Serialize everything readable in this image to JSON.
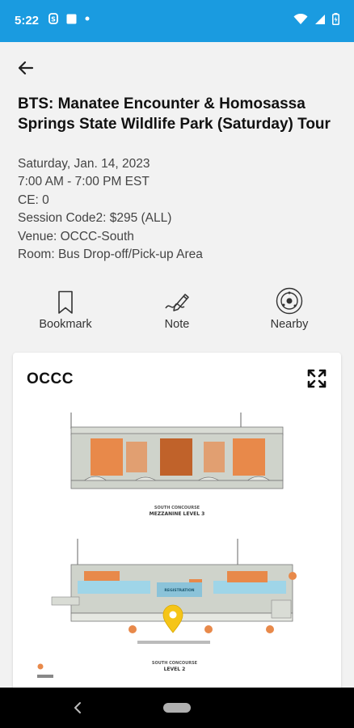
{
  "status_bar": {
    "time": "5:22"
  },
  "header": {
    "title": "BTS: Manatee Encounter & Homosassa Springs State Wildlife Park (Saturday) Tour"
  },
  "details": {
    "date": "Saturday, Jan. 14, 2023",
    "time": "7:00 AM - 7:00 PM EST",
    "ce": "CE: 0",
    "session_code": "Session Code2: $295 (ALL)",
    "venue": "Venue: OCCC-South",
    "room": "Room: Bus Drop-off/Pick-up Area"
  },
  "actions": {
    "bookmark": "Bookmark",
    "note": "Note",
    "nearby": "Nearby"
  },
  "map": {
    "title": "OCCC",
    "mezzanine_heading": "SOUTH CONCOURSE",
    "mezzanine_label": "MEZZANINE LEVEL 3",
    "level2_heading": "SOUTH CONCOURSE",
    "level2_label": "LEVEL 2",
    "registration_label": "REGISTRATION",
    "pin_color": "#f5c518",
    "accent_color": "#e8894a"
  },
  "colors": {
    "status_bar": "#1a9be0",
    "nav_bar": "#000000"
  }
}
